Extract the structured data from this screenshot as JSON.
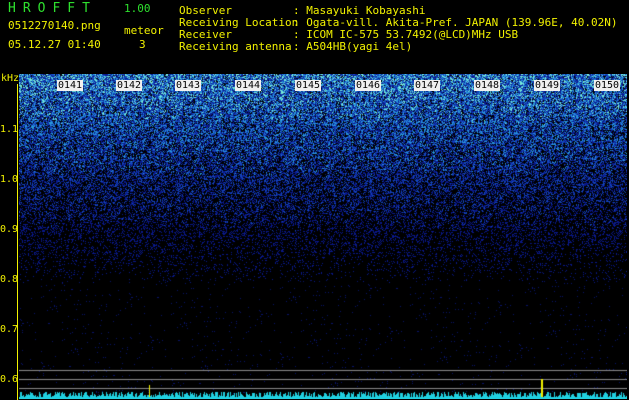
{
  "header": {
    "app_title": "HROFFT",
    "app_version": "1.00",
    "file_name": "0512270140.png",
    "meteor_label": "meteor",
    "datetime": "05.12.27 01:40",
    "meteor_count": "3"
  },
  "info": [
    {
      "key": "Observer",
      "value": ": Masayuki Kobayashi"
    },
    {
      "key": "Receiving Location",
      "value": ": Ogata-vill. Akita-Pref. JAPAN (139.96E, 40.02N)"
    },
    {
      "key": "Receiver",
      "value": ": ICOM IC-575 53.7492(@LCD)MHz USB"
    },
    {
      "key": "Receiving antenna",
      "value": ": A504HB(yagi 4el)"
    }
  ],
  "axis": {
    "unit": "kHz",
    "freq_ticks": [
      "1.1",
      "1.0",
      "0.9",
      "0.8",
      "0.7",
      "0.6"
    ],
    "time_ticks": [
      "0141",
      "0142",
      "0143",
      "0144",
      "0145",
      "0146",
      "0147",
      "0148",
      "0149",
      "0150"
    ]
  },
  "colors": {
    "background": "#000000",
    "text": "#f2f200",
    "title": "#2ee02e",
    "noise_low": "#0a1a8c",
    "noise_high": "#7df0d8"
  }
}
